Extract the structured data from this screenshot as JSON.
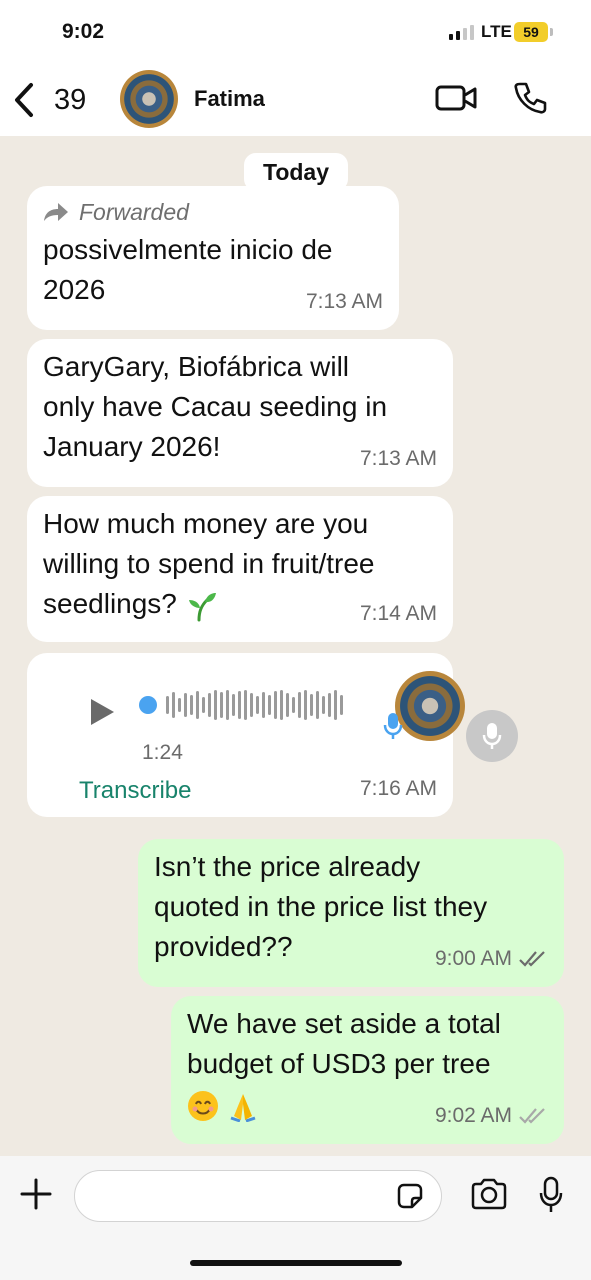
{
  "status_bar": {
    "time": "9:02",
    "network": "LTE",
    "battery": "59"
  },
  "header": {
    "back_count": "39",
    "contact_name": "Fatima"
  },
  "chat": {
    "date_label": "Today",
    "messages": [
      {
        "forwarded_label": "Forwarded",
        "text_line1": "possivelmente inicio de",
        "text_line2": "2026",
        "time": "7:13 AM"
      },
      {
        "text_line1": "GaryGary, Biofábrica will",
        "text_line2": "only have Cacau seeding in",
        "text_line3": "January 2026!",
        "time": "7:13 AM"
      },
      {
        "text_line1": "How much money are you",
        "text_line2": "willing to spend in fruit/tree",
        "text_line3": "seedlings?",
        "emoji": "seedling-emoji",
        "time": "7:14 AM"
      },
      {
        "voice_duration": "1:24",
        "transcribe_label": "Transcribe",
        "time": "7:16 AM"
      },
      {
        "text_line1": "Isn’t the price already",
        "text_line2": "quoted in the price list they",
        "text_line3": "provided??",
        "time": "9:00 AM",
        "status": "read"
      },
      {
        "text_line1": "We have set aside a total",
        "text_line2": "budget of USD3 per tree",
        "emojis": [
          "smiling-face-emoji",
          "folded-hands-emoji"
        ],
        "time": "9:02 AM",
        "status": "delivered"
      }
    ]
  },
  "composer": {
    "placeholder": ""
  },
  "colors": {
    "incoming_bubble": "#ffffff",
    "outgoing_bubble": "#d9fdd3",
    "accent_green": "#18836b",
    "read_ticks": "#53bdeb",
    "chat_bg": "#efeae2"
  }
}
